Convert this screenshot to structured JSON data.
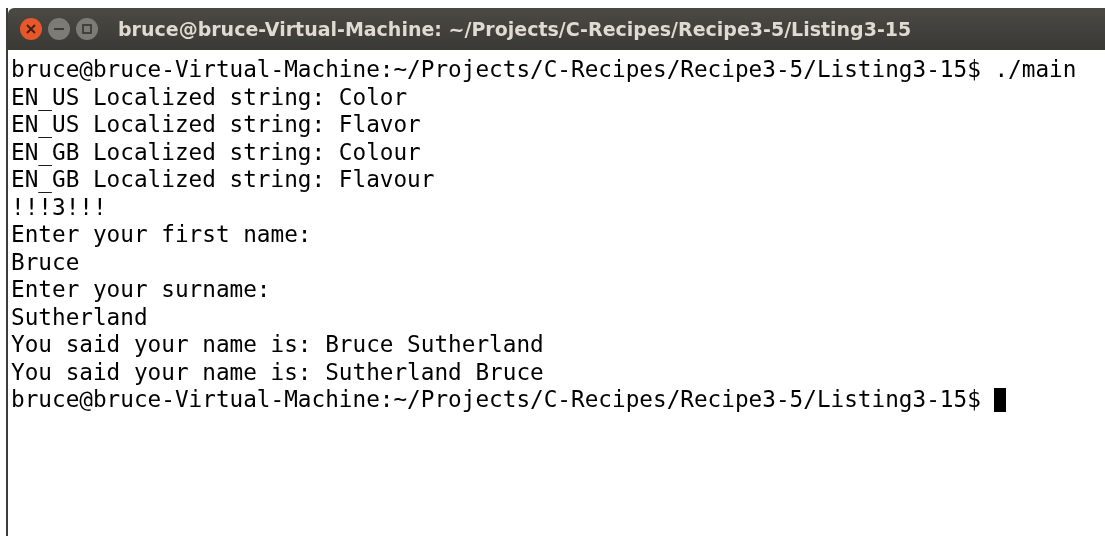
{
  "window": {
    "title": "bruce@bruce-Virtual-Machine: ~/Projects/C-Recipes/Recipe3-5/Listing3-15"
  },
  "terminal": {
    "lines": [
      {
        "text": "bruce@bruce-Virtual-Machine:~/Projects/C-Recipes/Recipe3-5/Listing3-15$ ./main",
        "cursor": false
      },
      {
        "text": "EN_US Localized string: Color",
        "cursor": false
      },
      {
        "text": "EN_US Localized string: Flavor",
        "cursor": false
      },
      {
        "text": "EN_GB Localized string: Colour",
        "cursor": false
      },
      {
        "text": "EN_GB Localized string: Flavour",
        "cursor": false
      },
      {
        "text": "!!!3!!!",
        "cursor": false
      },
      {
        "text": "Enter your first name:",
        "cursor": false
      },
      {
        "text": "Bruce",
        "cursor": false
      },
      {
        "text": "Enter your surname:",
        "cursor": false
      },
      {
        "text": "Sutherland",
        "cursor": false
      },
      {
        "text": "You said your name is: Bruce Sutherland",
        "cursor": false
      },
      {
        "text": "You said your name is: Sutherland Bruce",
        "cursor": false
      },
      {
        "text": "bruce@bruce-Virtual-Machine:~/Projects/C-Recipes/Recipe3-5/Listing3-15$",
        "cursor": true
      }
    ]
  }
}
